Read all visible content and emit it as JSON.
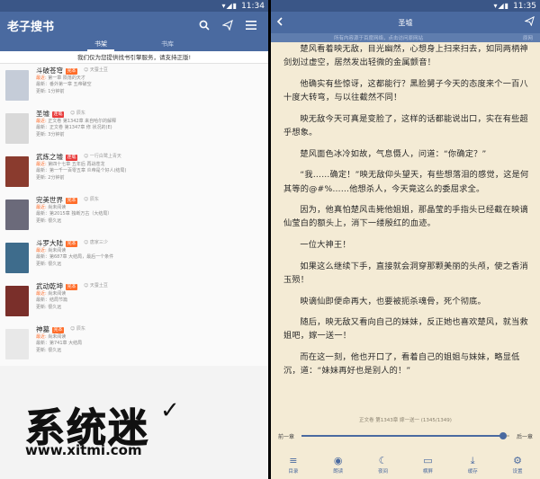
{
  "left": {
    "status_time": "11:34",
    "app_title": "老子搜书",
    "tabs": [
      "书架",
      "书库"
    ],
    "notice": "我们仅为您提供找书引擎服务，请支持正版!",
    "labels": {
      "latest": "最近:",
      "updated": "更新:"
    },
    "books": [
      {
        "title": "斗破苍穹",
        "badge": "完本",
        "badge_color": "#ff6d2a",
        "author": "天蚕土豆",
        "latest": "第一章 陨落的天才",
        "chapter": "最新：番外第一章 五帝破空",
        "updated": "1分钟前",
        "cover": "#c5ccd8"
      },
      {
        "title": "圣墟",
        "badge": "连载",
        "badge_color": "#e83b3b",
        "author": "辰东",
        "latest": "正文卷 第1342章 来自哈尔的解释",
        "chapter": "最新：正文卷 第1347章 修 状况的(E)",
        "updated": "3分钟前",
        "cover": "#d9d9d9"
      },
      {
        "title": "武炼之墟",
        "badge": "连载",
        "badge_color": "#e83b3b",
        "author": "一行白鹭上青天",
        "latest": "第四十七章 五年后 再战苍龙",
        "chapter": "最新：第一千一百零五章 炎帝是个好人(结局)",
        "updated": "2分钟前",
        "cover": "#8a3b2e"
      },
      {
        "title": "完美世界",
        "badge": "完本",
        "badge_color": "#ff6d2a",
        "author": "辰东",
        "latest": "尚未阅读",
        "chapter": "最新：第2015章 独断万古（大结局）",
        "updated": "很久远",
        "cover": "#6b6a7a"
      },
      {
        "title": "斗罗大陆",
        "badge": "完本",
        "badge_color": "#ff6d2a",
        "author": "唐家三少",
        "latest": "尚未阅读",
        "chapter": "最新：第687章 大结局，最后一个条件",
        "updated": "很久远",
        "cover": "#3e6c8c"
      },
      {
        "title": "武动乾坤",
        "badge": "完本",
        "badge_color": "#ff6d2a",
        "author": "天蚕土豆",
        "latest": "尚未阅读",
        "chapter": "最新：结局节篇",
        "updated": "很久远",
        "cover": "#7a2f2a"
      },
      {
        "title": "神墓",
        "badge": "完本",
        "badge_color": "#ff6d2a",
        "author": "辰东",
        "latest": "尚未阅读",
        "chapter": "最新：第741章 大结局",
        "updated": "很久远",
        "cover": "#e8e8e8"
      }
    ],
    "watermark": {
      "logo": "系统迷",
      "url": "www.xitmi.com",
      "mark": "✓"
    }
  },
  "right": {
    "status_time": "11:35",
    "title": "圣墟",
    "source_notice": "所有内容源于百度网络，点击访问原网站",
    "source_link": "原网",
    "paragraphs": [
      "楚风看着映无敌，目光幽然，心想身上扫来扫去，如同两柄神剑划过虚空，居然发出轻微的金属颤音！",
      "他确实有些惊讶，这都能行？黑脸舅子今天的态度来个一百八十度大转弯，与以往截然不同！",
      "映无敌今天可真是变脸了，这样的话都能说出口，实在有些超乎想象。",
      "楚风面色冰冷如故，气息慑人，问道：“你确定？”",
      "“我……确定！”映无敌仰头望天，有些想落泪的感觉，这是何其等的@#%……他想杀人，今天竟这么的委屈求全。",
      "因为，他真怕楚风击毙他姐姐，那晶莹的手指头已经截在映谪仙莹白的额头上，消下一缕殷红的血迹。",
      "一位大神王！",
      "如果这么继续下手，直接就会洞穿那颗美丽的头颅，使之香消玉殒！",
      "映谪仙即便命再大，也要被扼杀魂骨，死个彻底。",
      "随后，映无敌又看向自己的妹妹，反正她也喜欢楚风，就当救姐吧，嫁一送一！",
      "而在这一刻，他也开口了，看着自己的姐姐与妹妹，略显低沉，道：“妹妹再好也是别人的！”"
    ],
    "chapter_info": "正文卷 第1343章 嫁一送一 (1345/1349)",
    "prev_label": "前一章",
    "next_label": "后一章",
    "progress": 0.97,
    "bottom_items": [
      {
        "label": "目录",
        "icon": "≡",
        "name": "catalog"
      },
      {
        "label": "朗读",
        "icon": "◉",
        "name": "read-aloud"
      },
      {
        "label": "夜间",
        "icon": "☾",
        "name": "night-mode"
      },
      {
        "label": "横屏",
        "icon": "▭",
        "name": "landscape"
      },
      {
        "label": "缓存",
        "icon": "⤓",
        "name": "cache"
      },
      {
        "label": "设置",
        "icon": "⚙",
        "name": "settings"
      }
    ]
  }
}
